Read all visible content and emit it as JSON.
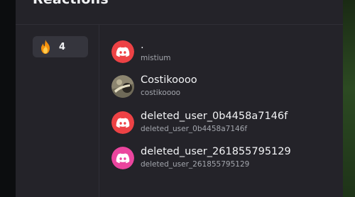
{
  "modal": {
    "title": "Reactions"
  },
  "reactions": [
    {
      "emoji": "fire-emoji",
      "count": "4"
    }
  ],
  "users": [
    {
      "name": ".",
      "handle": "mistium",
      "avatar": "discord-logo-red"
    },
    {
      "name": "Costikoooo",
      "handle": "costikoooo",
      "avatar": "photo-avatar"
    },
    {
      "name": "deleted_user_0b4458a7146f",
      "handle": "deleted_user_0b4458a7146f",
      "avatar": "discord-logo-red"
    },
    {
      "name": "deleted_user_261855795129",
      "handle": "deleted_user_261855795129",
      "avatar": "discord-logo-pink"
    }
  ],
  "colors": {
    "modal_bg": "#242329",
    "chip_bg": "#35353d",
    "avatar_red": "#ed4245",
    "avatar_pink": "#eb459e",
    "text_primary": "#f2f3f5",
    "text_secondary": "#a3a6ad"
  }
}
